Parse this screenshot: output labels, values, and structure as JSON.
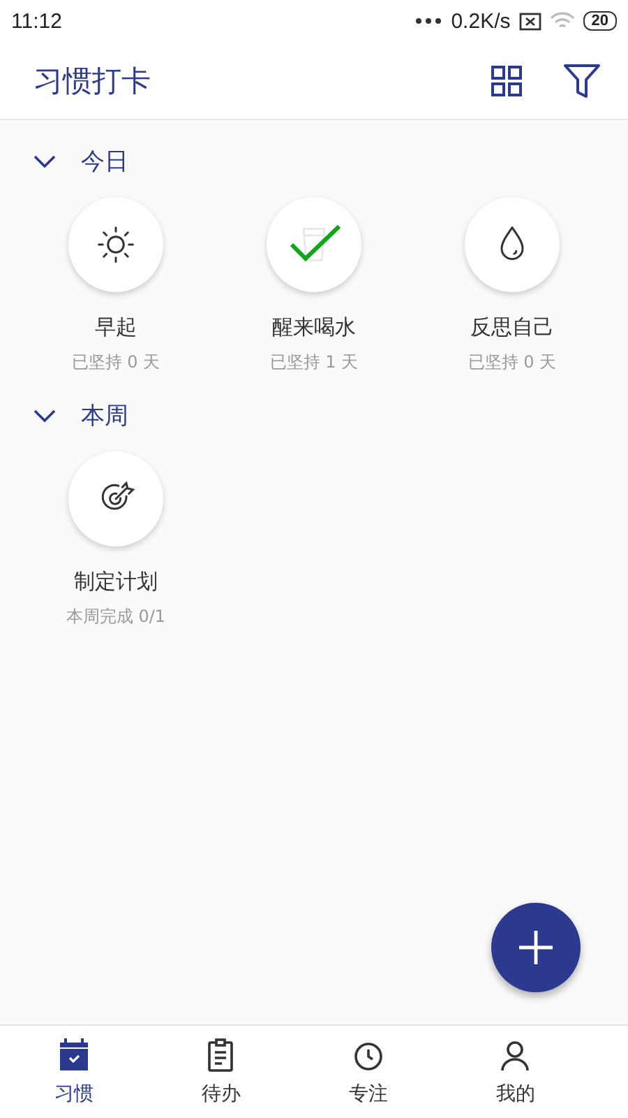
{
  "status_bar": {
    "time": "11:12",
    "speed": "0.2K/s",
    "battery": "20"
  },
  "app_bar": {
    "title": "习惯打卡"
  },
  "sections": [
    {
      "title": "今日",
      "expanded": true,
      "habits": [
        {
          "name": "早起",
          "progress": "已坚持 0 天",
          "checked": false
        },
        {
          "name": "醒来喝水",
          "progress": "已坚持 1 天",
          "checked": true
        },
        {
          "name": "反思自己",
          "progress": "已坚持 0 天",
          "checked": false
        }
      ]
    },
    {
      "title": "本周",
      "expanded": true,
      "habits": [
        {
          "name": "制定计划",
          "progress": "本周完成 0/1",
          "checked": false
        }
      ]
    }
  ],
  "bottom_nav": [
    {
      "label": "习惯",
      "selected": true
    },
    {
      "label": "待办",
      "selected": false
    },
    {
      "label": "专注",
      "selected": false
    },
    {
      "label": "我的",
      "selected": false
    }
  ]
}
